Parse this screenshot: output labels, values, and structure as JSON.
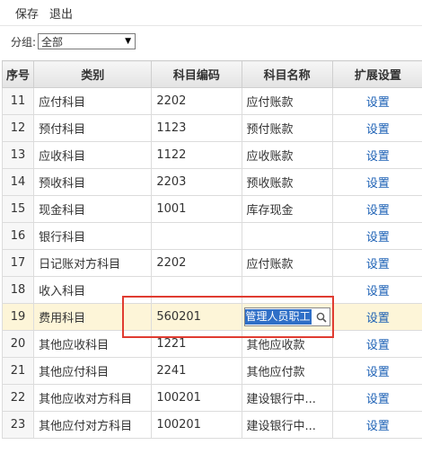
{
  "toolbar": {
    "save_label": "保存",
    "exit_label": "退出"
  },
  "filter": {
    "label": "分组:",
    "selected": "全部"
  },
  "table": {
    "headers": {
      "seq": "序号",
      "category": "类别",
      "code": "科目编码",
      "name": "科目名称",
      "ext": "扩展设置"
    },
    "rows": [
      {
        "seq": "11",
        "category": "应付科目",
        "code": "2202",
        "name": "应付账款",
        "ext": "设置"
      },
      {
        "seq": "12",
        "category": "预付科目",
        "code": "1123",
        "name": "预付账款",
        "ext": "设置"
      },
      {
        "seq": "13",
        "category": "应收科目",
        "code": "1122",
        "name": "应收账款",
        "ext": "设置"
      },
      {
        "seq": "14",
        "category": "预收科目",
        "code": "2203",
        "name": "预收账款",
        "ext": "设置"
      },
      {
        "seq": "15",
        "category": "现金科目",
        "code": "1001",
        "name": "库存现金",
        "ext": "设置"
      },
      {
        "seq": "16",
        "category": "银行科目",
        "code": "",
        "name": "",
        "ext": "设置"
      },
      {
        "seq": "17",
        "category": "日记账对方科目",
        "code": "2202",
        "name": "应付账款",
        "ext": "设置"
      },
      {
        "seq": "18",
        "category": "收入科目",
        "code": "",
        "name": "",
        "ext": "设置"
      },
      {
        "seq": "19",
        "category": "费用科目",
        "code": "560201",
        "name": "管理人员职工",
        "ext": "设置"
      },
      {
        "seq": "20",
        "category": "其他应收科目",
        "code": "1221",
        "name": "其他应收款",
        "ext": "设置"
      },
      {
        "seq": "21",
        "category": "其他应付科目",
        "code": "2241",
        "name": "其他应付款",
        "ext": "设置"
      },
      {
        "seq": "22",
        "category": "其他应收对方科目",
        "code": "100201",
        "name": "建设银行中...",
        "ext": "设置"
      },
      {
        "seq": "23",
        "category": "其他应付对方科目",
        "code": "100201",
        "name": "建设银行中...",
        "ext": "设置"
      }
    ]
  },
  "icons": {
    "dropdown": "chevron-down-icon",
    "lookup": "search-icon"
  },
  "colors": {
    "selected_row": "#fdf5d8",
    "link": "#1a5fb4",
    "highlight_border": "#e03c31",
    "text_selection": "#2f6fc7"
  }
}
